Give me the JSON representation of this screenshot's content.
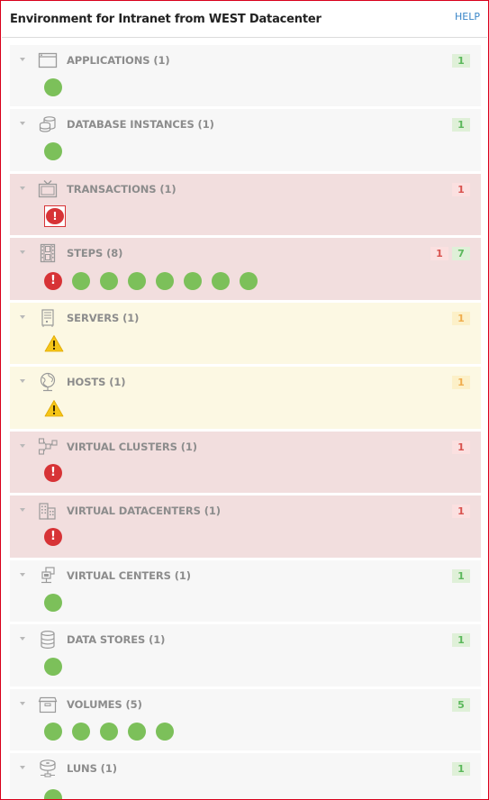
{
  "header": {
    "title": "Environment for Intranet from WEST Datacenter",
    "help": "HELP"
  },
  "sections": [
    {
      "key": "applications",
      "label": "APPLICATIONS (1)",
      "icon": "application-window-icon",
      "state": "ok",
      "badges": [
        {
          "type": "ok",
          "count": "1"
        }
      ],
      "items": [
        {
          "status": "ok"
        }
      ]
    },
    {
      "key": "database-instances",
      "label": "DATABASE INSTANCES (1)",
      "icon": "database-instances-icon",
      "state": "ok",
      "badges": [
        {
          "type": "ok",
          "count": "1"
        }
      ],
      "items": [
        {
          "status": "ok"
        }
      ]
    },
    {
      "key": "transactions",
      "label": "TRANSACTIONS (1)",
      "icon": "tv-monitor-icon",
      "state": "critical",
      "badges": [
        {
          "type": "critical",
          "count": "1"
        }
      ],
      "items": [
        {
          "status": "critical-selected"
        }
      ]
    },
    {
      "key": "steps",
      "label": "STEPS (8)",
      "icon": "film-strip-icon",
      "state": "critical",
      "badges": [
        {
          "type": "critical",
          "count": "1"
        },
        {
          "type": "ok",
          "count": "7"
        }
      ],
      "items": [
        {
          "status": "critical"
        },
        {
          "status": "ok"
        },
        {
          "status": "ok"
        },
        {
          "status": "ok"
        },
        {
          "status": "ok"
        },
        {
          "status": "ok"
        },
        {
          "status": "ok"
        },
        {
          "status": "ok"
        }
      ]
    },
    {
      "key": "servers",
      "label": "SERVERS (1)",
      "icon": "server-icon",
      "state": "warning",
      "badges": [
        {
          "type": "warning",
          "count": "1"
        }
      ],
      "items": [
        {
          "status": "warning"
        }
      ]
    },
    {
      "key": "hosts",
      "label": "HOSTS (1)",
      "icon": "globe-host-icon",
      "state": "warning",
      "badges": [
        {
          "type": "warning",
          "count": "1"
        }
      ],
      "items": [
        {
          "status": "warning"
        }
      ]
    },
    {
      "key": "virtual-clusters",
      "label": "VIRTUAL CLUSTERS (1)",
      "icon": "cluster-icon",
      "state": "critical",
      "badges": [
        {
          "type": "critical",
          "count": "1"
        }
      ],
      "items": [
        {
          "status": "critical"
        }
      ]
    },
    {
      "key": "virtual-datacenters",
      "label": "VIRTUAL DATACENTERS (1)",
      "icon": "datacenter-building-icon",
      "state": "critical",
      "badges": [
        {
          "type": "critical",
          "count": "1"
        }
      ],
      "items": [
        {
          "status": "critical"
        }
      ]
    },
    {
      "key": "virtual-centers",
      "label": "VIRTUAL CENTERS (1)",
      "icon": "virtual-center-icon",
      "state": "ok",
      "badges": [
        {
          "type": "ok",
          "count": "1"
        }
      ],
      "items": [
        {
          "status": "ok"
        }
      ]
    },
    {
      "key": "data-stores",
      "label": "DATA STORES (1)",
      "icon": "data-store-icon",
      "state": "ok",
      "badges": [
        {
          "type": "ok",
          "count": "1"
        }
      ],
      "items": [
        {
          "status": "ok"
        }
      ]
    },
    {
      "key": "volumes",
      "label": "VOLUMES (5)",
      "icon": "volume-box-icon",
      "state": "ok",
      "badges": [
        {
          "type": "ok",
          "count": "5"
        }
      ],
      "items": [
        {
          "status": "ok"
        },
        {
          "status": "ok"
        },
        {
          "status": "ok"
        },
        {
          "status": "ok"
        },
        {
          "status": "ok"
        }
      ]
    },
    {
      "key": "luns",
      "label": "LUNS (1)",
      "icon": "lun-disk-icon",
      "state": "ok",
      "badges": [
        {
          "type": "ok",
          "count": "1"
        }
      ],
      "items": [
        {
          "status": "ok"
        }
      ]
    }
  ],
  "colors": {
    "ok": "#7cc05a",
    "critical": "#d73336",
    "warning": "#f5c518",
    "ok_bg": "#f7f7f7",
    "critical_bg": "#f2dede",
    "warning_bg": "#fcf8e3",
    "frame": "#d9001b"
  }
}
